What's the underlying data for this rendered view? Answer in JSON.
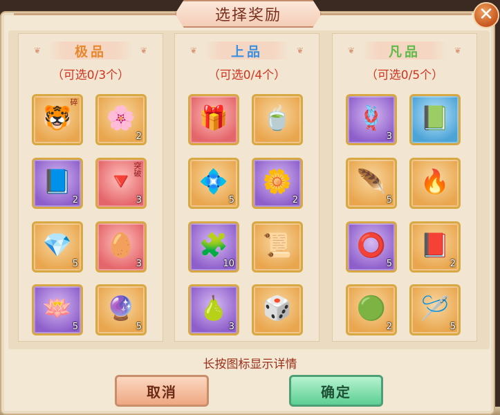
{
  "dialog": {
    "title": "选择奖励",
    "close_glyph": "✕",
    "hint": "长按图标显示详情",
    "cancel_label": "取消",
    "confirm_label": "确定"
  },
  "columns": [
    {
      "title": "极品",
      "title_color": "#e8872d",
      "subtitle": "（可选0/3个）",
      "items": [
        {
          "icon": "white-tiger-icon",
          "glyph": "🐯",
          "tint": "orange",
          "count": "",
          "tag": "碎"
        },
        {
          "icon": "orange-flower-icon",
          "glyph": "🌸",
          "tint": "orange",
          "count": "2",
          "tag": ""
        },
        {
          "icon": "blue-book-icon",
          "glyph": "📘",
          "tint": "purple",
          "count": "2",
          "tag": ""
        },
        {
          "icon": "red-crystal-icon",
          "glyph": "🔻",
          "tint": "red",
          "count": "3",
          "tag": "突破"
        },
        {
          "icon": "purple-crystal-icon",
          "glyph": "💎",
          "tint": "orange",
          "count": "5",
          "tag": ""
        },
        {
          "icon": "blue-egg-icon",
          "glyph": "🥚",
          "tint": "red",
          "count": "3",
          "tag": ""
        },
        {
          "icon": "lotus-icon",
          "glyph": "🪷",
          "tint": "purple",
          "count": "5",
          "tag": ""
        },
        {
          "icon": "purple-orb-icon",
          "glyph": "🔮",
          "tint": "orange",
          "count": "5",
          "tag": ""
        }
      ]
    },
    {
      "title": "上品",
      "title_color": "#3a8fe0",
      "subtitle": "（可选0/4个）",
      "items": [
        {
          "icon": "gift-box-icon",
          "glyph": "🎁",
          "tint": "red",
          "count": "",
          "tag": ""
        },
        {
          "icon": "jade-pendant-icon",
          "glyph": "🍵",
          "tint": "orange",
          "count": "",
          "tag": ""
        },
        {
          "icon": "sapphire-icon",
          "glyph": "💠",
          "tint": "orange",
          "count": "5",
          "tag": ""
        },
        {
          "icon": "white-flower-icon",
          "glyph": "🌼",
          "tint": "purple",
          "count": "2",
          "tag": ""
        },
        {
          "icon": "puzzle-piece-icon",
          "glyph": "🧩",
          "tint": "purple",
          "count": "10",
          "tag": ""
        },
        {
          "icon": "magic-scroll-icon",
          "glyph": "📜",
          "tint": "orange",
          "count": "",
          "tag": ""
        },
        {
          "icon": "jade-gourd-icon",
          "glyph": "🍐",
          "tint": "purple",
          "count": "3",
          "tag": ""
        },
        {
          "icon": "dice-bag-icon",
          "glyph": "🎲",
          "tint": "orange",
          "count": "",
          "tag": ""
        }
      ]
    },
    {
      "title": "凡品",
      "title_color": "#5fb94a",
      "subtitle": "（可选0/5个）",
      "items": [
        {
          "icon": "jade-knot-icon",
          "glyph": "🪢",
          "tint": "purple",
          "count": "3",
          "tag": ""
        },
        {
          "icon": "blue-tome-icon",
          "glyph": "📗",
          "tint": "blue",
          "count": "",
          "tag": ""
        },
        {
          "icon": "feather-icon",
          "glyph": "🪶",
          "tint": "orange",
          "count": "5",
          "tag": ""
        },
        {
          "icon": "campfire-icon",
          "glyph": "🔥",
          "tint": "orange",
          "count": "",
          "tag": ""
        },
        {
          "icon": "jade-ring-icon",
          "glyph": "⭕",
          "tint": "purple",
          "count": "5",
          "tag": ""
        },
        {
          "icon": "red-book-icon",
          "glyph": "📕",
          "tint": "orange",
          "count": "2",
          "tag": ""
        },
        {
          "icon": "green-orb-icon",
          "glyph": "🟢",
          "tint": "orange",
          "count": "2",
          "tag": ""
        },
        {
          "icon": "needle-thread-icon",
          "glyph": "🪡",
          "tint": "orange",
          "count": "5",
          "tag": ""
        }
      ]
    }
  ]
}
